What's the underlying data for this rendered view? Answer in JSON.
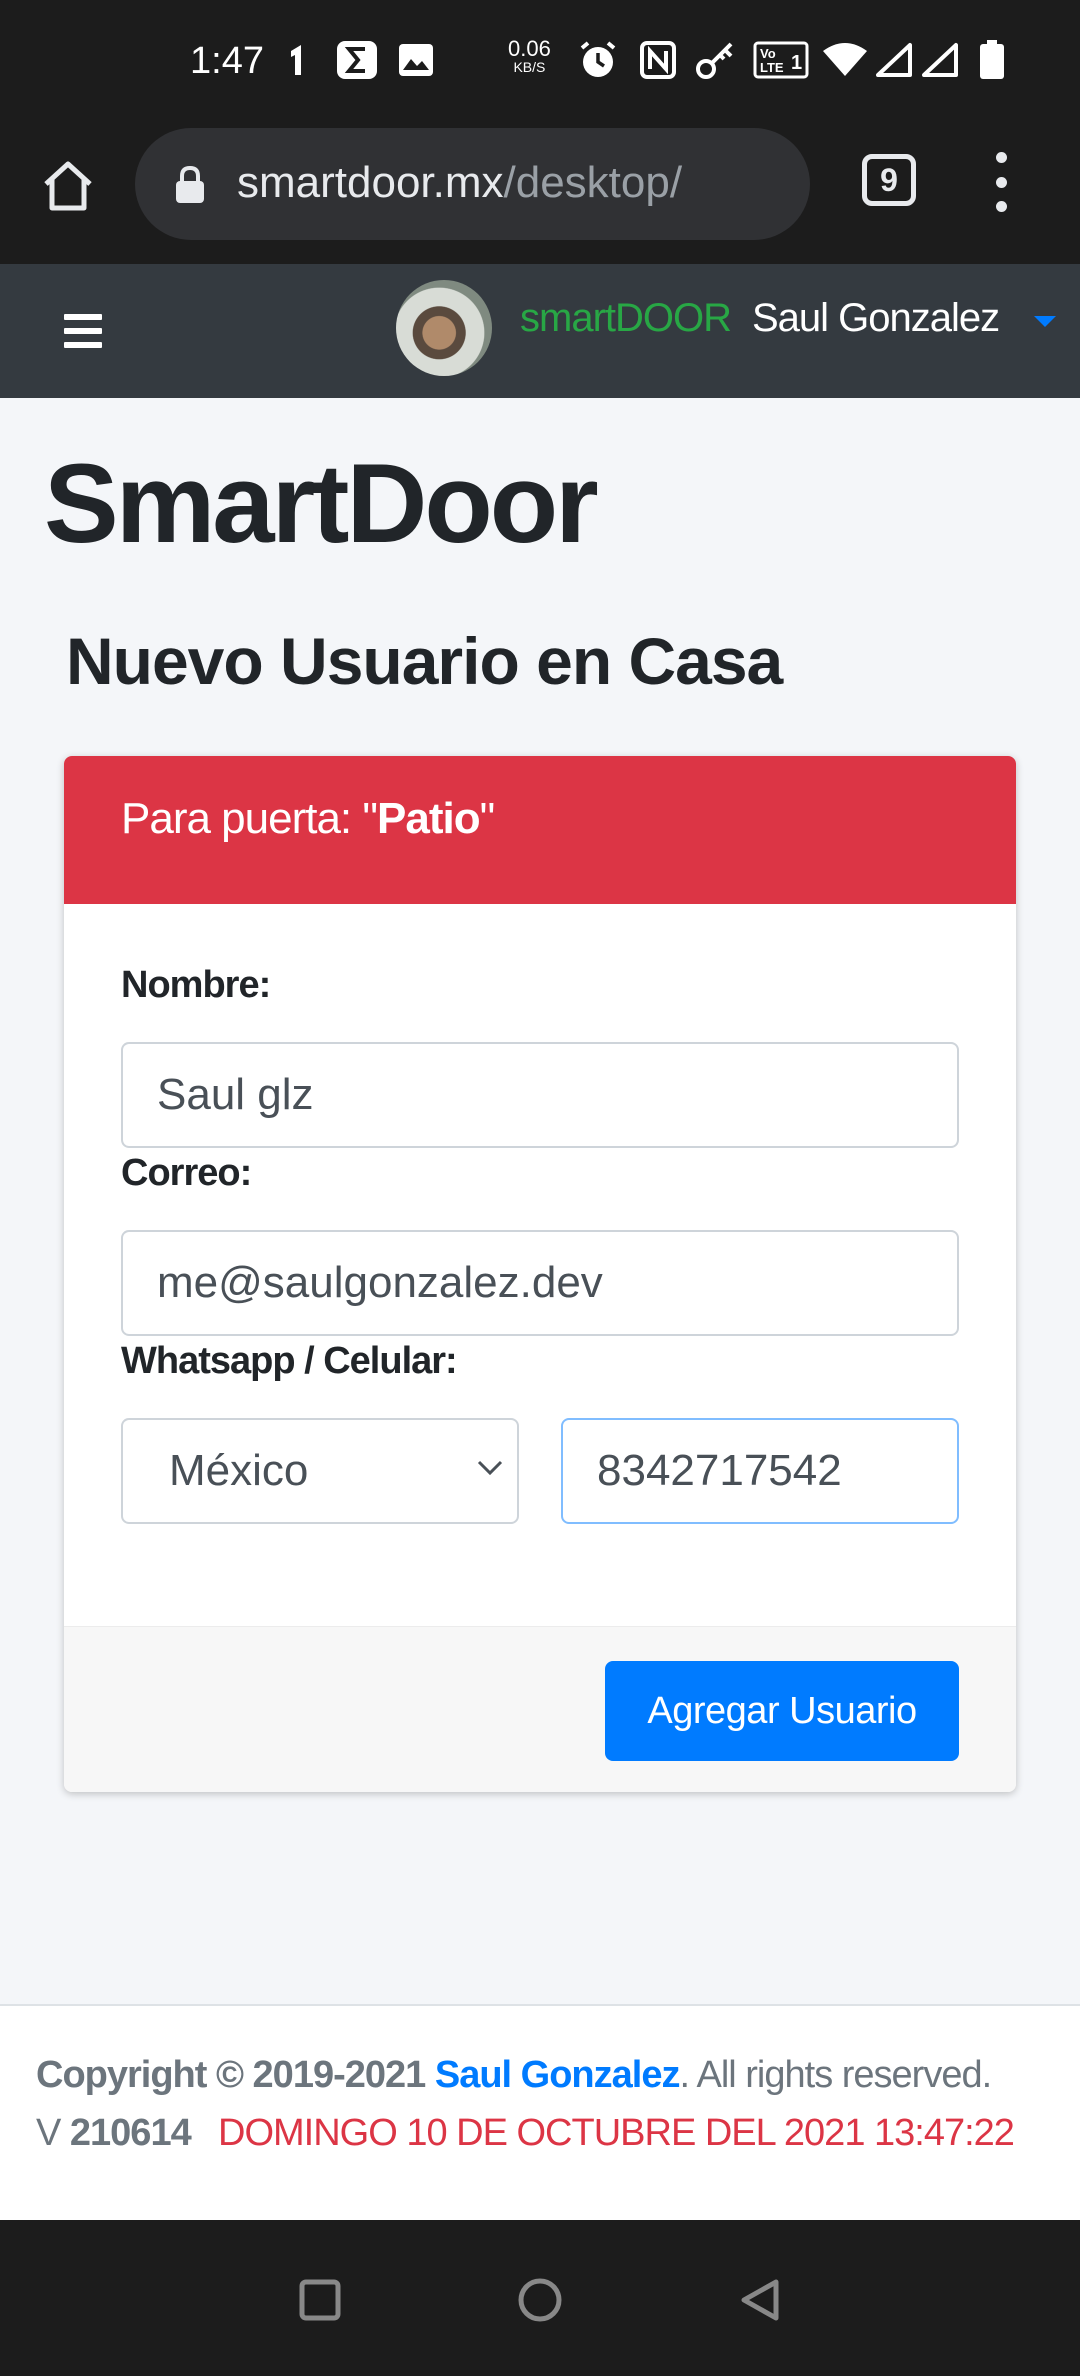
{
  "status_bar": {
    "time": "1:47",
    "net_speed": "0.06",
    "net_unit": "KB/S",
    "icons": [
      "notification-icon",
      "sigma-app-icon",
      "image-icon",
      "alarm-icon",
      "nfc-icon",
      "vpn-key-icon",
      "volte-icon",
      "wifi-icon",
      "signal-icon",
      "signal-icon-2",
      "battery-icon"
    ]
  },
  "browser": {
    "url_domain": "smartdoor.mx",
    "url_path": "/desktop/",
    "tab_count": "9"
  },
  "nav": {
    "brand": "smartDOOR",
    "user_name": "Saul Gonzalez"
  },
  "page": {
    "title": "SmartDoor",
    "subtitle_prefix": "Nuevo Usuario en ",
    "subtitle_place": "Casa"
  },
  "card": {
    "header_prefix": "Para puerta: \"",
    "door_name": "Patio",
    "header_suffix": "\"",
    "name_label": "Nombre:",
    "name_value": "Saul glz",
    "email_label": "Correo:",
    "email_value": "me@saulgonzalez.dev",
    "phone_label": "Whatsapp / Celular:",
    "country_selected": "México",
    "phone_value": "8342717542",
    "submit_label": "Agregar Usuario"
  },
  "footer": {
    "copyright_prefix": "Copyright © ",
    "years": "2019-2021",
    "author": "Saul Gonzalez",
    "rights": ". All rights reserved.",
    "version_prefix": "V ",
    "version": "210614",
    "datetime": "DOMINGO 10 DE OCTUBRE DEL 2021 13:47:22"
  },
  "colors": {
    "brand_green": "#28a745",
    "danger_red": "#dc3545",
    "primary_blue": "#007bff",
    "navbar_dark": "#343a40"
  }
}
